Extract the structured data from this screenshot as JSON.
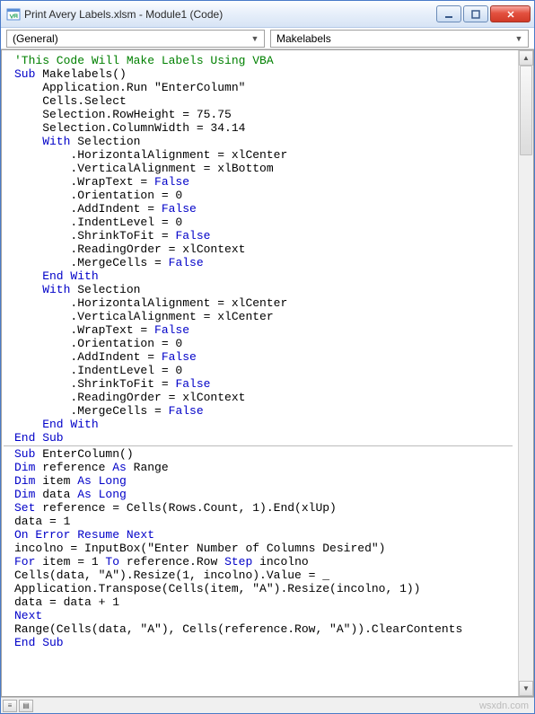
{
  "window": {
    "title": "Print Avery Labels.xlsm - Module1 (Code)"
  },
  "dropdowns": {
    "scope": "(General)",
    "proc": "Makelabels"
  },
  "code": {
    "comment": "'This Code Will Make Labels Using VBA",
    "sub1": {
      "declare_sub": "Sub",
      "name": " Makelabels()",
      "l1": "    Application.Run \"EnterColumn\"",
      "l2": "    Cells.Select",
      "l3": "    Selection.RowHeight = 75.75",
      "l4": "    Selection.ColumnWidth = 34.14",
      "with1_kw": "    With",
      "with1_rest": " Selection",
      "w1a": "        .HorizontalAlignment = xlCenter",
      "w1b": "        .VerticalAlignment = xlBottom",
      "w1c_pre": "        .WrapText = ",
      "w1c_kw": "False",
      "w1d": "        .Orientation = 0",
      "w1e_pre": "        .AddIndent = ",
      "w1e_kw": "False",
      "w1f": "        .IndentLevel = 0",
      "w1g_pre": "        .ShrinkToFit = ",
      "w1g_kw": "False",
      "w1h": "        .ReadingOrder = xlContext",
      "w1i_pre": "        .MergeCells = ",
      "w1i_kw": "False",
      "endwith1": "    End With",
      "with2_kw": "    With",
      "with2_rest": " Selection",
      "w2a": "        .HorizontalAlignment = xlCenter",
      "w2b": "        .VerticalAlignment = xlCenter",
      "w2c_pre": "        .WrapText = ",
      "w2c_kw": "False",
      "w2d": "        .Orientation = 0",
      "w2e_pre": "        .AddIndent = ",
      "w2e_kw": "False",
      "w2f": "        .IndentLevel = 0",
      "w2g_pre": "        .ShrinkToFit = ",
      "w2g_kw": "False",
      "w2h": "        .ReadingOrder = xlContext",
      "w2i_pre": "        .MergeCells = ",
      "w2i_kw": "False",
      "endwith2": "    End With",
      "endsub": "End Sub"
    },
    "sub2": {
      "declare_sub": "Sub",
      "name": " EnterColumn()",
      "dim1_kw": "Dim",
      "dim1_mid": " reference ",
      "dim1_as": "As",
      "dim1_type": " Range",
      "dim2_kw": "Dim",
      "dim2_mid": " item ",
      "dim2_as": "As Long",
      "dim3_kw": "Dim",
      "dim3_mid": " data ",
      "dim3_as": "As Long",
      "set_kw": "Set",
      "set_rest": " reference = Cells(Rows.Count, 1).End(xlUp)",
      "data1": "data = 1",
      "onerr": "On Error Resume Next",
      "incol": "incolno = InputBox(\"Enter Number of Columns Desired\")",
      "for_kw": "For",
      "for_mid": " item = 1 ",
      "for_to": "To",
      "for_mid2": " reference.Row ",
      "for_step": "Step",
      "for_rest": " incolno",
      "cells_line": "Cells(data, \"A\").Resize(1, incolno).Value = _",
      "app_line": "Application.Transpose(Cells(item, \"A\").Resize(incolno, 1))",
      "data2": "data = data + 1",
      "next": "Next",
      "range_line": "Range(Cells(data, \"A\"), Cells(reference.Row, \"A\")).ClearContents",
      "endsub": "End Sub"
    }
  },
  "watermark": "wsxdn.com"
}
